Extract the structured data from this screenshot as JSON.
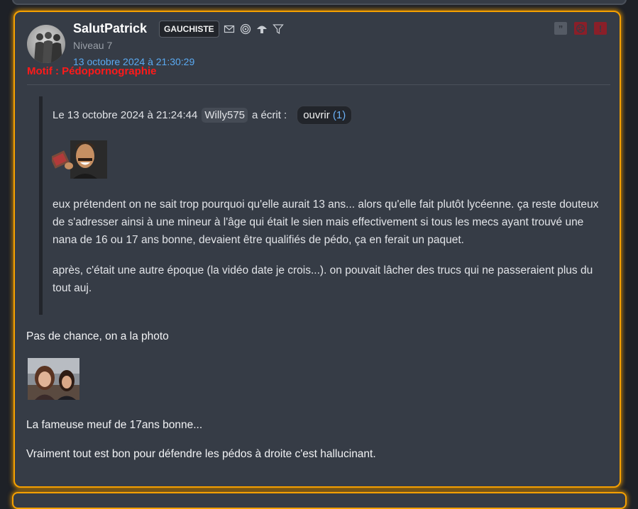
{
  "post": {
    "username": "SalutPatrick",
    "badge": "GAUCHISTE",
    "level": "Niveau 7",
    "date": "13 octobre 2024 à 21:30:29",
    "motif": "Motif : Pédopornographie",
    "profile_icons": [
      "mail-icon",
      "spiral-icon",
      "mushroom-icon",
      "filter-icon"
    ],
    "actions": {
      "quote_glyph": "”",
      "block_glyph": "☹",
      "report_glyph": "!"
    },
    "quote": {
      "prefix": "Le 13 octobre 2024 à 21:24:44",
      "author": "Willy575",
      "suffix": "a écrit :",
      "open_label": "ouvrir",
      "open_count": "(1)",
      "paragraphs": [
        "eux prétendent on ne sait trop pourquoi qu'elle aurait 13 ans... alors qu'elle fait plutôt lycéenne. ça reste douteux de s'adresser ainsi à une mineur à l'âge qui était le sien mais effectivement si tous les mecs ayant trouvé une nana de 16 ou 17 ans bonne, devaient être qualifiés de pédo, ça en ferait un paquet.",
        "après, c'était une autre époque (la vidéo date je crois...). on pouvait lâcher des trucs qui ne passeraient plus du tout auj."
      ]
    },
    "body": [
      "Pas de chance, on a la photo",
      "La fameuse meuf de 17ans bonne...",
      "Vraiment tout est bon pour défendre les pédos à droite c'est hallucinant."
    ]
  },
  "colors": {
    "highlight_border": "#f5a000",
    "post_bg": "#363c46",
    "page_bg": "#1e2127",
    "link_blue": "#5aaaf2",
    "alert_red": "#ff1a1a"
  }
}
